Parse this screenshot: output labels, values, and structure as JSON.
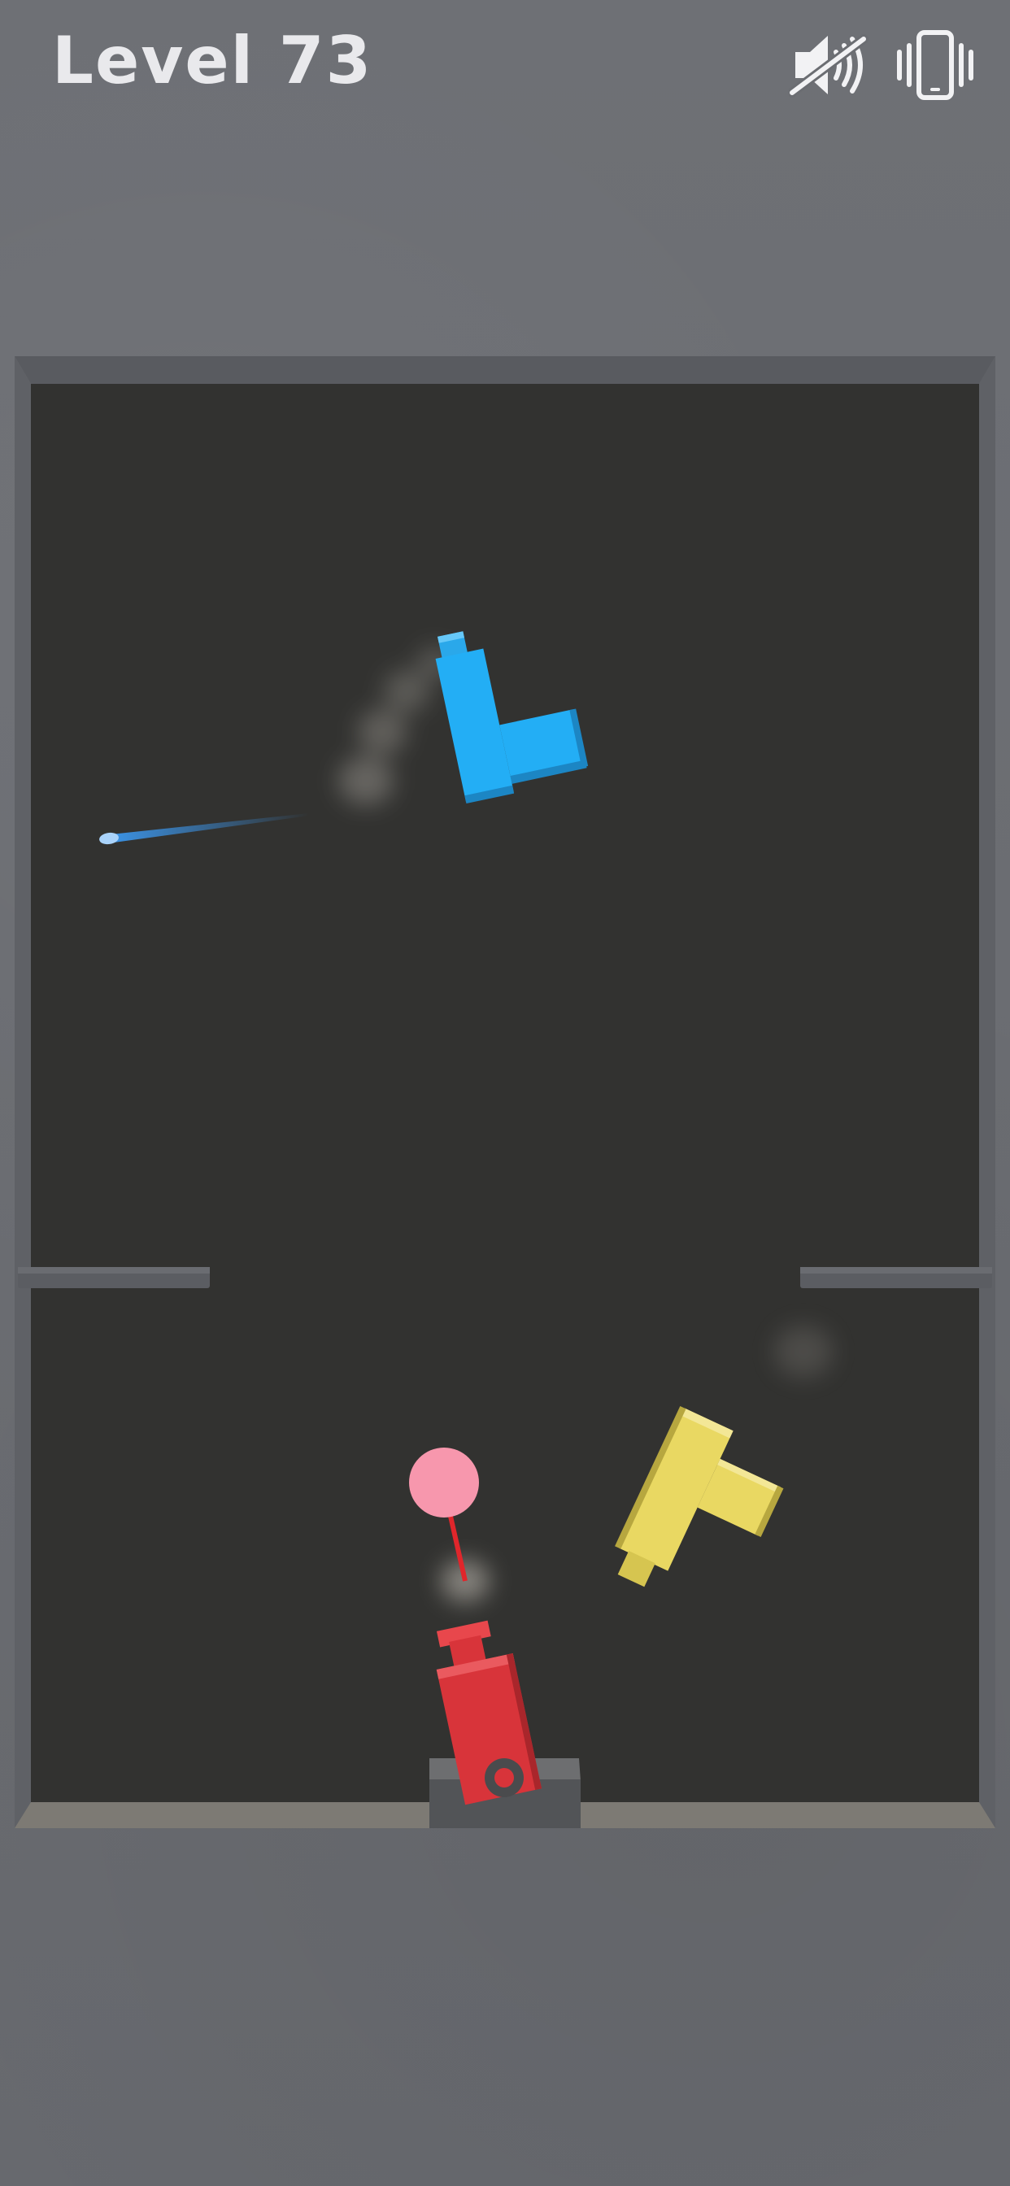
{
  "hud": {
    "level_label": "Level 73"
  },
  "controls": {
    "sound": {
      "icon": "speaker-muted-icon",
      "state": "muted"
    },
    "vibration": {
      "icon": "phone-vibrate-icon",
      "state": "on"
    }
  },
  "colors": {
    "wall": "#6b6d72",
    "play_area": "#323230",
    "frame": "#5c5e63",
    "floor": "#7d7a74",
    "player_cannon": "#d8343a",
    "blue_cannon": "#23aef5",
    "yellow_cannon": "#e9d862",
    "target_ball": "#f797ad",
    "laser": "#e0262b",
    "projectile": "#3b93e6"
  }
}
